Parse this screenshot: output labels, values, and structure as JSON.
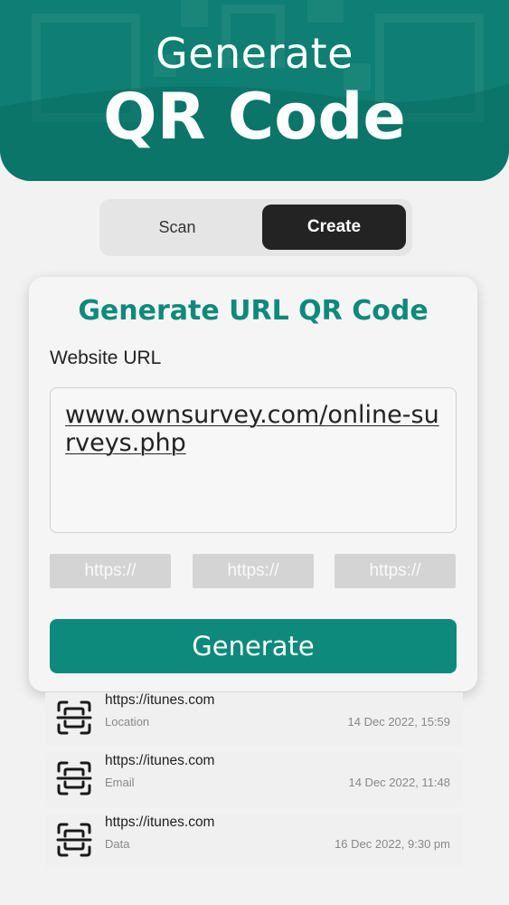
{
  "header": {
    "title_line1": "Generate",
    "title_line2": "QR Code"
  },
  "mode_toggle": {
    "scan_label": "Scan",
    "create_label": "Create",
    "selected": "Create"
  },
  "card": {
    "title": "Generate URL QR Code",
    "field_label": "Website URL",
    "url_value": "www.ownsurvey.com/online-surveys.php",
    "chips": [
      "https://",
      "https://",
      "https://"
    ],
    "generate_label": "Generate"
  },
  "history": [
    {
      "url": "https://itunes.com",
      "type": "Location",
      "date": "14 Dec 2022, 15:59"
    },
    {
      "url": "https://itunes.com",
      "type": "Email",
      "date": "14 Dec 2022, 11:48"
    },
    {
      "url": "https://itunes.com",
      "type": "Data",
      "date": "16 Dec 2022, 9:30 pm"
    }
  ],
  "colors": {
    "primary": "#0e8a7c",
    "header": "#0e7f72",
    "toggle_active": "#232323",
    "chip": "#d4d4d4",
    "background": "#f2f2f2"
  },
  "icons": {
    "history_item": "qr-scan-icon"
  }
}
